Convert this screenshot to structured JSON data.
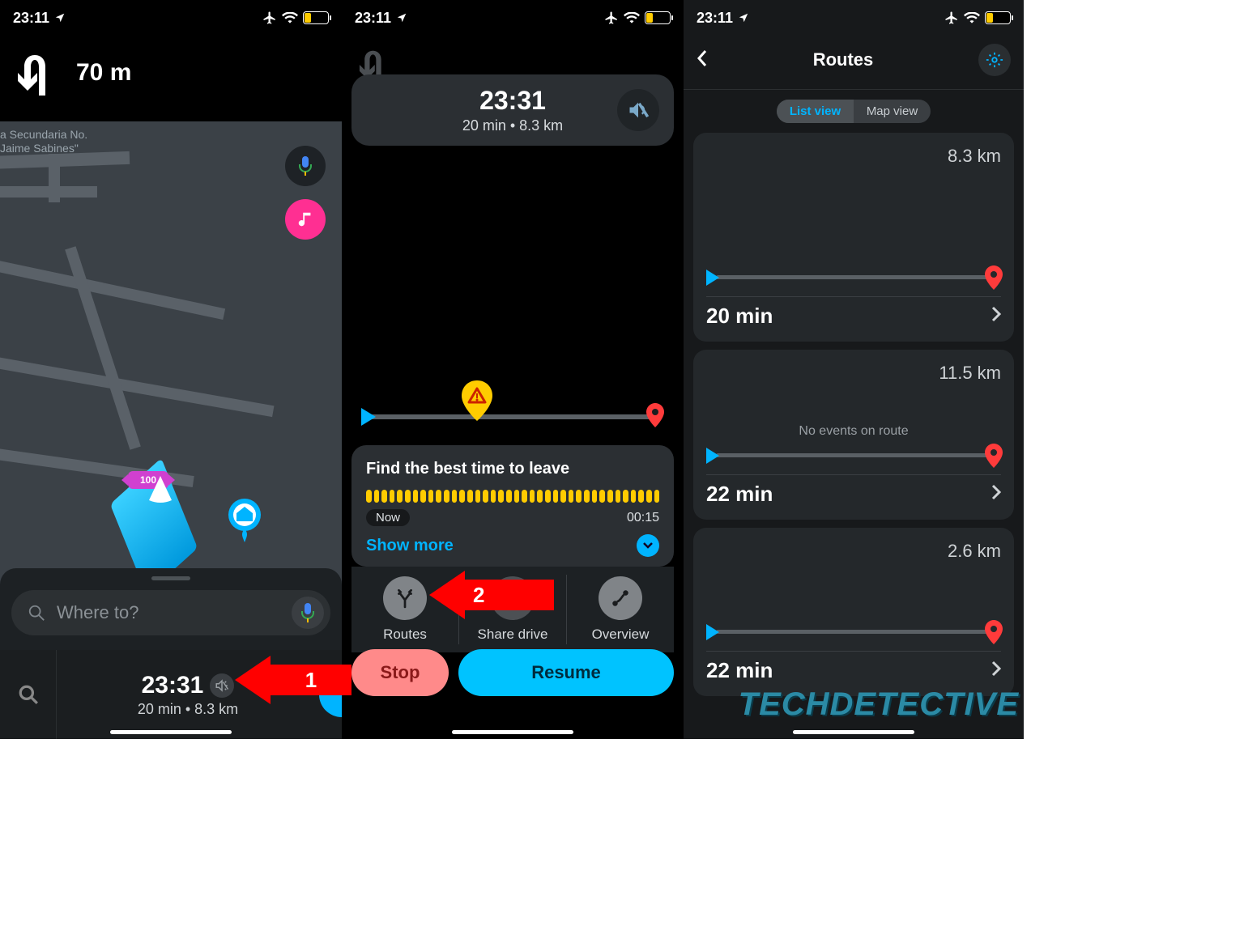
{
  "status": {
    "time": "23:11",
    "battery1": "28",
    "battery2": "28",
    "battery3": "27"
  },
  "p1": {
    "turn_distance": "70 m",
    "map_label": "a Secundaria No.\nJaime Sabines\"",
    "candy": "100",
    "search_placeholder": "Where to?",
    "eta_time": "23:31",
    "eta_sub": "20 min  •  8.3 km"
  },
  "p2": {
    "eta_time": "23:31",
    "eta_sub": "20 min  •  8.3 km",
    "leave_title": "Find the best time to leave",
    "now_label": "Now",
    "later_label": "00:15",
    "show_more": "Show more",
    "routes": "Routes",
    "share": "Share drive",
    "overview": "Overview",
    "stop": "Stop",
    "resume": "Resume"
  },
  "p3": {
    "title": "Routes",
    "list": "List view",
    "map": "Map view",
    "routes": [
      {
        "dist": "8.3 km",
        "time": "20 min",
        "noev": ""
      },
      {
        "dist": "11.5 km",
        "time": "22 min",
        "noev": "No events on route"
      },
      {
        "dist": "2.6 km",
        "time": "22 min",
        "noev": ""
      }
    ]
  },
  "annotations": {
    "a1": "1",
    "a2": "2"
  },
  "watermark": "TECHDETECTIVE"
}
